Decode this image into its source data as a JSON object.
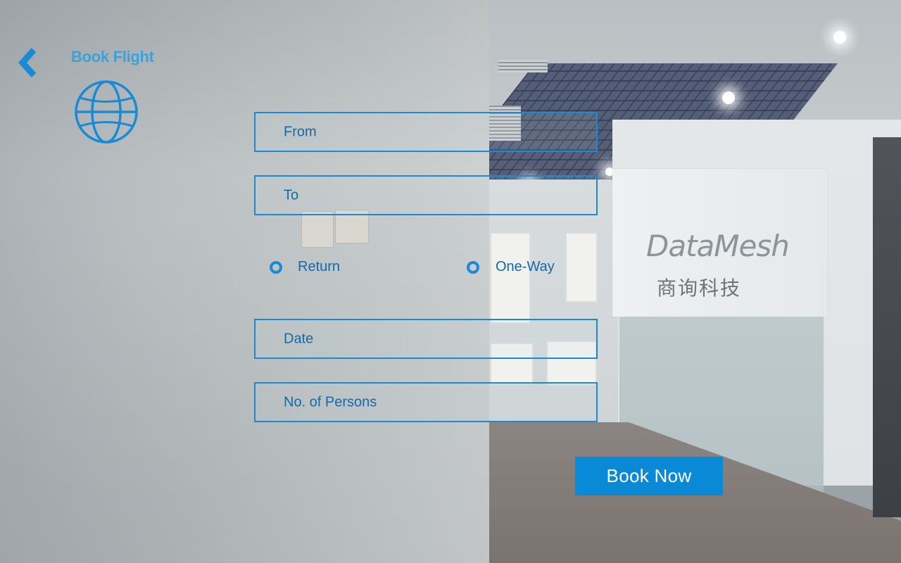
{
  "header": {
    "back_icon": "chevron-left-icon",
    "title": "Book Flight",
    "app_icon": "globe-icon"
  },
  "form": {
    "from": {
      "placeholder": "From",
      "value": ""
    },
    "to": {
      "placeholder": "To",
      "value": ""
    },
    "trip_type": {
      "options": [
        {
          "label": "Return",
          "selected": false
        },
        {
          "label": "One-Way",
          "selected": false
        }
      ]
    },
    "date": {
      "placeholder": "Date",
      "value": ""
    },
    "persons": {
      "placeholder": "No. of Persons",
      "value": ""
    }
  },
  "actions": {
    "book_label": "Book Now"
  },
  "background": {
    "sign_brand": "DataMesh",
    "sign_sub": "商询科技"
  },
  "colors": {
    "accent": "#1a8ad6",
    "text": "#136aa8",
    "title": "#3ba1d8",
    "button_bg": "#0a8ad6",
    "button_text": "#ffffff"
  }
}
